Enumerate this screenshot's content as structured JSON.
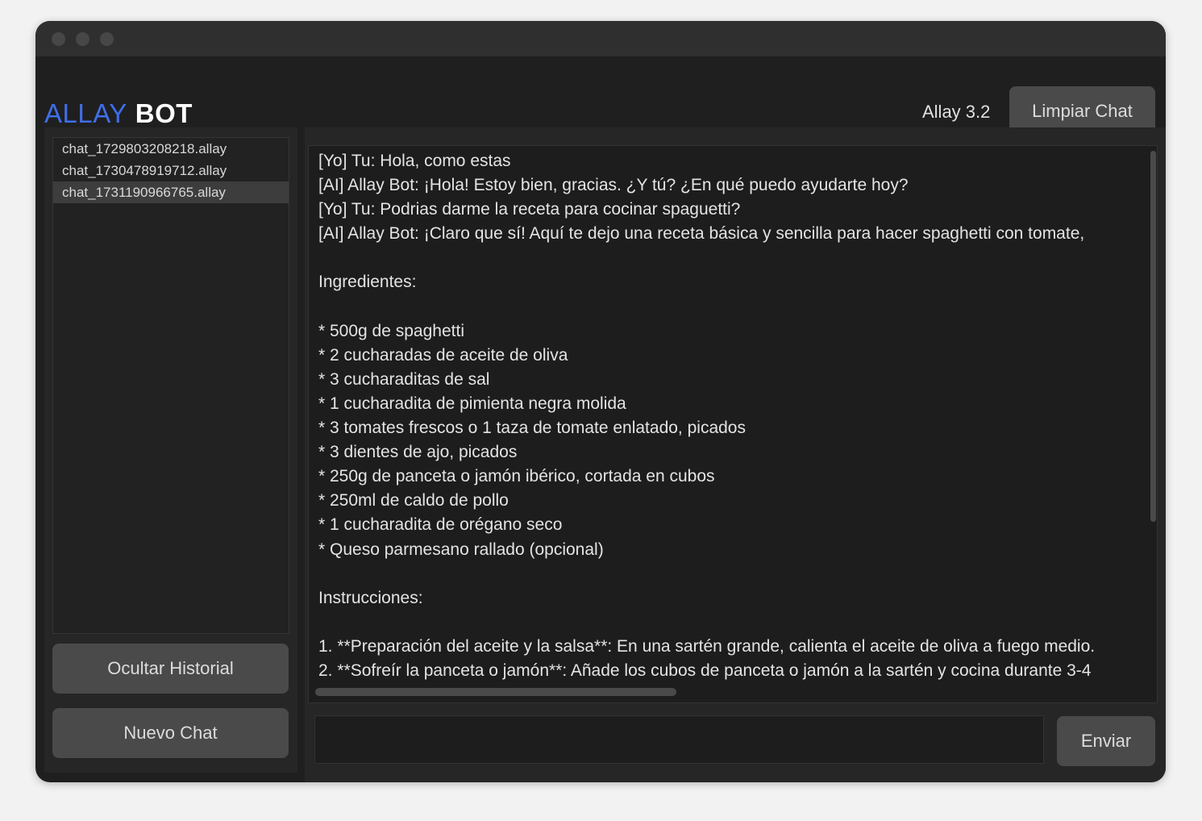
{
  "app": {
    "logo_allay": "ALLAY",
    "logo_bot": "BOT",
    "version": "Allay 3.2",
    "clear_label": "Limpiar Chat"
  },
  "sidebar": {
    "history": [
      {
        "label": "chat_1729803208218.allay",
        "selected": false
      },
      {
        "label": "chat_1730478919712.allay",
        "selected": false
      },
      {
        "label": "chat_1731190966765.allay",
        "selected": true
      }
    ],
    "hide_history_label": "Ocultar Historial",
    "new_chat_label": "Nuevo Chat"
  },
  "chat": {
    "lines": [
      "[Yo] Tu: Hola, como estas",
      "[AI] Allay Bot: ¡Hola! Estoy bien, gracias. ¿Y tú? ¿En qué puedo ayudarte hoy?",
      "[Yo] Tu: Podrias darme la receta para cocinar spaguetti?",
      "[AI] Allay Bot: ¡Claro que sí! Aquí te dejo una receta básica y sencilla para hacer spaghetti con tomate,",
      "",
      "Ingredientes:",
      "",
      "* 500g de spaghetti",
      "* 2 cucharadas de aceite de oliva",
      "* 3 cucharaditas de sal",
      "* 1 cucharadita de pimienta negra molida",
      "* 3 tomates frescos o 1 taza de tomate enlatado, picados",
      "* 3 dientes de ajo, picados",
      "* 250g de panceta o jamón ibérico, cortada en cubos",
      "* 250ml de caldo de pollo",
      "* 1 cucharadita de orégano seco",
      "* Queso parmesano rallado (opcional)",
      "",
      "Instrucciones:",
      "",
      "1. **Preparación del aceite y la salsa**: En una sartén grande, calienta el aceite de oliva a fuego medio.",
      "2. **Sofreír la panceta o jamón**: Añade los cubos de panceta o jamón a la sartén y cocina durante 3-4"
    ],
    "input_value": "",
    "send_label": "Enviar"
  }
}
